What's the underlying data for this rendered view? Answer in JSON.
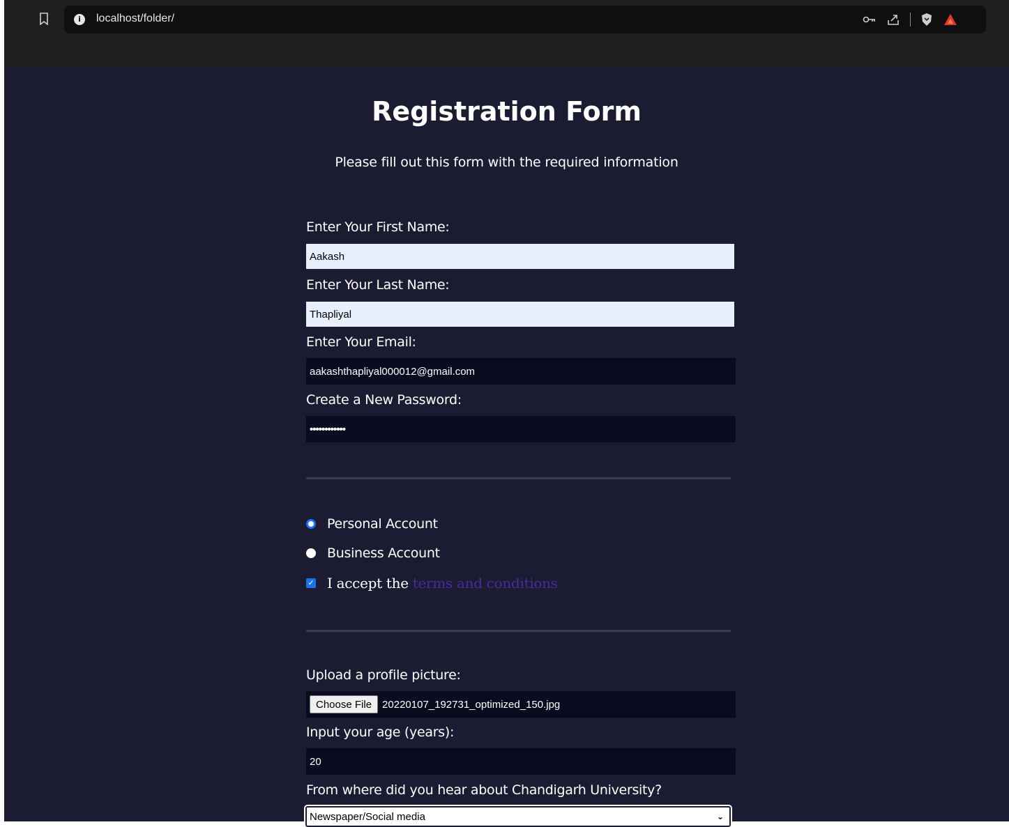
{
  "browser": {
    "url": "localhost/folder/",
    "info_icon": "i"
  },
  "form": {
    "title": "Registration Form",
    "subtitle": "Please fill out this form with the required information",
    "first_name": {
      "label": "Enter Your First Name:",
      "value": "Aakash"
    },
    "last_name": {
      "label": "Enter Your Last Name:",
      "value": "Thapliyal"
    },
    "email": {
      "label": "Enter Your Email:",
      "value": "aakashthapliyal000012@gmail.com"
    },
    "password": {
      "label": "Create a New Password:",
      "value": "••••••••••••"
    },
    "account_type": {
      "options": [
        {
          "label": "Personal Account",
          "checked": true
        },
        {
          "label": "Business Account",
          "checked": false
        }
      ]
    },
    "terms": {
      "checked": true,
      "text": "I accept the",
      "link": "terms and conditions"
    },
    "profile_picture": {
      "label": "Upload a profile picture:",
      "button": "Choose File",
      "file_name": "20220107_192731_optimized_150.jpg"
    },
    "age": {
      "label": "Input your age (years):",
      "value": "20"
    },
    "referrer": {
      "label": "From where did you hear about Chandigarh University?",
      "selected": "Newspaper/Social media"
    }
  },
  "colors": {
    "page_background": "#1b1c32",
    "input_dark": "#0b0b1f",
    "autofill": "#e8f0fe",
    "accent": "#1a73e8",
    "link": "#4a2a9c"
  }
}
